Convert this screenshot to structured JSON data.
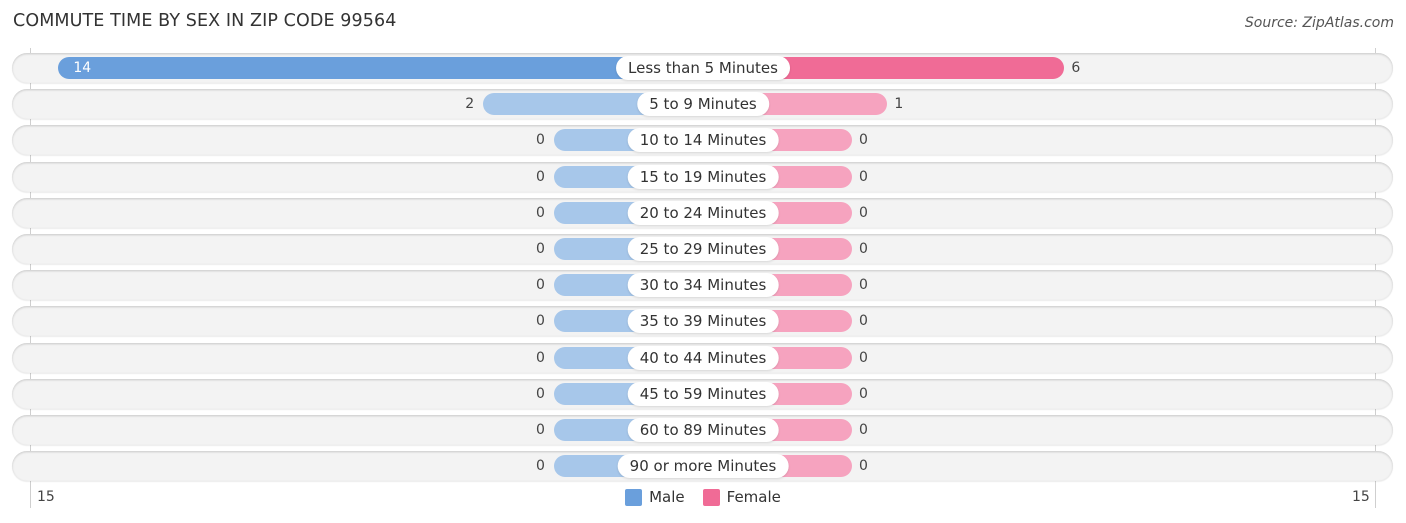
{
  "chart_data": {
    "type": "bar",
    "orientation": "horizontal-diverging",
    "title": "COMMUTE TIME BY SEX IN ZIP CODE 99564",
    "source": "Source: ZipAtlas.com",
    "categories": [
      "Less than 5 Minutes",
      "5 to 9 Minutes",
      "10 to 14 Minutes",
      "15 to 19 Minutes",
      "20 to 24 Minutes",
      "25 to 29 Minutes",
      "30 to 34 Minutes",
      "35 to 39 Minutes",
      "40 to 44 Minutes",
      "45 to 59 Minutes",
      "60 to 89 Minutes",
      "90 or more Minutes"
    ],
    "series": [
      {
        "name": "Male",
        "color": "#6a9fdc",
        "light_color": "#a7c7ea",
        "values": [
          14,
          2,
          0,
          0,
          0,
          0,
          0,
          0,
          0,
          0,
          0,
          0
        ]
      },
      {
        "name": "Female",
        "color": "#f06b96",
        "light_color": "#f6a3bf",
        "values": [
          6,
          1,
          0,
          0,
          0,
          0,
          0,
          0,
          0,
          0,
          0,
          0
        ]
      }
    ],
    "axis": {
      "left_tick": "15",
      "right_tick": "15",
      "max": 15
    },
    "legend": {
      "position": "bottom-center",
      "entries": [
        "Male",
        "Female"
      ]
    }
  }
}
